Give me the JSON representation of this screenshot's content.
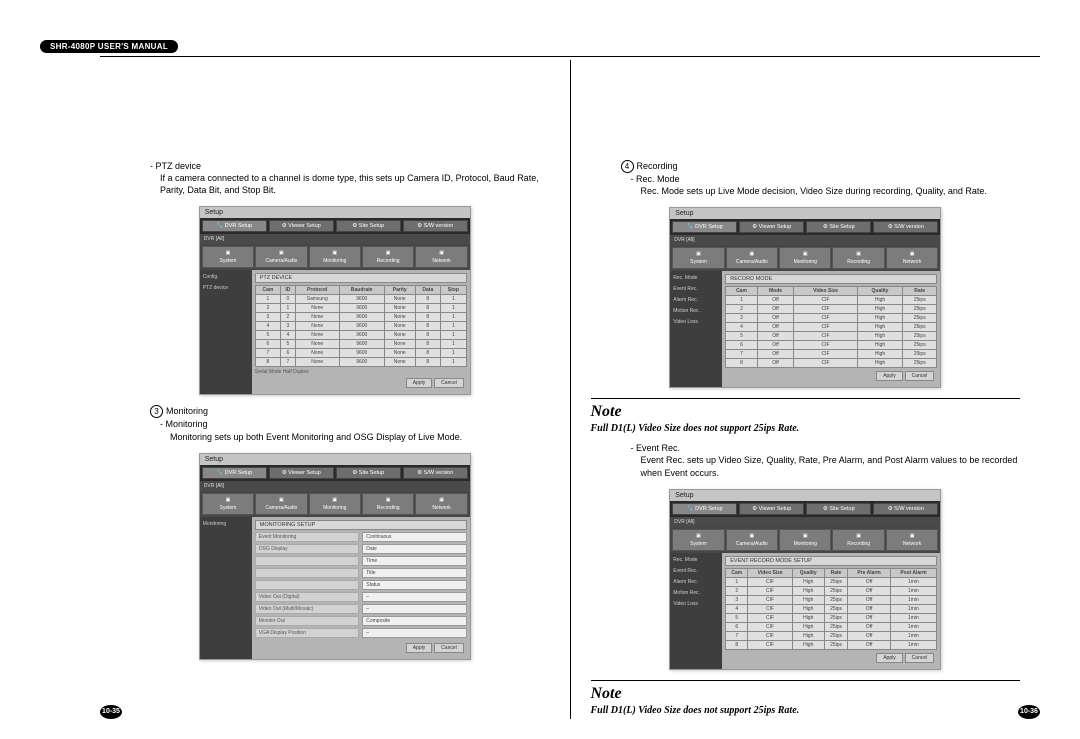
{
  "header": "SHR-4080P USER'S MANUAL",
  "left": {
    "ptz": {
      "bullet": "- PTZ device",
      "text": "If a camera connected to a channel is dome type, this sets up Camera ID, Protocol, Baud Rate, Parity, Data Bit, and Stop Bit."
    },
    "mon_num": "3",
    "mon": {
      "head": "Monitoring",
      "bullet": "- Monitoring",
      "text": "Monitoring sets up both Event Monitoring and OSG Display of Live Mode."
    },
    "page": "10-35",
    "shot1": {
      "setup": "Setup",
      "tabs": [
        "DVR Setup",
        "Viewer Setup",
        "Site Setup",
        "S/W version"
      ],
      "nav": [
        "System",
        "Camera/Audio",
        "Monitoring",
        "Recording",
        "Network"
      ],
      "side": [
        "Config.",
        "PTZ device"
      ],
      "panel": "PTZ DEVICE",
      "headers": [
        "Cam",
        "ID",
        "Protocol",
        "Baudrate",
        "Parity",
        "Data",
        "Stop"
      ],
      "rows": [
        [
          "1",
          "0",
          "Samsung",
          "9600",
          "None",
          "8",
          "1"
        ],
        [
          "2",
          "1",
          "None",
          "9600",
          "None",
          "8",
          "1"
        ],
        [
          "3",
          "2",
          "None",
          "9600",
          "None",
          "8",
          "1"
        ],
        [
          "4",
          "3",
          "None",
          "9600",
          "None",
          "8",
          "1"
        ],
        [
          "5",
          "4",
          "None",
          "9600",
          "None",
          "8",
          "1"
        ],
        [
          "6",
          "5",
          "None",
          "9600",
          "None",
          "8",
          "1"
        ],
        [
          "7",
          "6",
          "None",
          "9600",
          "None",
          "8",
          "1"
        ],
        [
          "8",
          "7",
          "None",
          "9600",
          "None",
          "8",
          "1"
        ]
      ],
      "serial": "Serial Mode   Half Duplex",
      "btns": [
        "Apply",
        "Cancel"
      ]
    },
    "shot2": {
      "setup": "Setup",
      "tabs": [
        "DVR Setup",
        "Viewer Setup",
        "Site Setup",
        "S/W version"
      ],
      "nav": [
        "System",
        "Camera/Audio",
        "Monitoring",
        "Recording",
        "Network"
      ],
      "side": [
        "Monitoring"
      ],
      "panel": "MONITORING SETUP",
      "form": [
        [
          "Event Monitoring",
          "Continuous"
        ],
        [
          "OSG Display",
          "Date"
        ],
        [
          "",
          "Time"
        ],
        [
          "",
          "Title"
        ],
        [
          "",
          "Status"
        ],
        [
          "Video Out (Digital)",
          "–"
        ],
        [
          "Video Out (Multi/Mosaic)",
          "–"
        ],
        [
          "Monitor Out",
          "Composite"
        ],
        [
          "VGA Display Position",
          "–"
        ]
      ],
      "btns": [
        "Apply",
        "Cancel"
      ]
    }
  },
  "right": {
    "rec_num": "4",
    "rec": {
      "head": "Recording",
      "bullet": "- Rec. Mode",
      "text": "Rec. Mode sets up Live Mode decision, Video Size during recording, Quality, and Rate."
    },
    "note": "Note",
    "note_text": "Full D1(L) Video Size does not support 25ips Rate.",
    "event": {
      "bullet": "- Event Rec.",
      "text": "Event Rec. sets up Video Size, Quality, Rate, Pre Alarm, and Post Alarm values to be recorded when Event occurs."
    },
    "page": "10-36",
    "shot1": {
      "setup": "Setup",
      "tabs": [
        "DVR Setup",
        "Viewer Setup",
        "Site Setup",
        "S/W version"
      ],
      "nav": [
        "System",
        "Camera/Audio",
        "Monitoring",
        "Recording",
        "Network"
      ],
      "side": [
        "Rec. Mode",
        "Event Rec.",
        "Alarm Rec.",
        "Motion Rec.",
        "Video Loss"
      ],
      "panel": "RECORD MODE",
      "headers": [
        "Cam",
        "Mode",
        "Video Size",
        "Quality",
        "Rate"
      ],
      "rows": [
        [
          "1",
          "Off",
          "CIF",
          "High",
          "25ips"
        ],
        [
          "2",
          "Off",
          "CIF",
          "High",
          "25ips"
        ],
        [
          "3",
          "Off",
          "CIF",
          "High",
          "25ips"
        ],
        [
          "4",
          "Off",
          "CIF",
          "High",
          "25ips"
        ],
        [
          "5",
          "Off",
          "CIF",
          "High",
          "25ips"
        ],
        [
          "6",
          "Off",
          "CIF",
          "High",
          "25ips"
        ],
        [
          "7",
          "Off",
          "CIF",
          "High",
          "25ips"
        ],
        [
          "8",
          "Off",
          "CIF",
          "High",
          "25ips"
        ]
      ],
      "btns": [
        "Apply",
        "Cancel"
      ]
    },
    "shot2": {
      "setup": "Setup",
      "tabs": [
        "DVR Setup",
        "Viewer Setup",
        "Site Setup",
        "S/W version"
      ],
      "nav": [
        "System",
        "Camera/Audio",
        "Monitoring",
        "Recording",
        "Network"
      ],
      "side": [
        "Rec. Mode",
        "Event Rec.",
        "Alarm Rec.",
        "Motion Rec.",
        "Video Loss"
      ],
      "panel": "EVENT RECORD MODE SETUP",
      "headers": [
        "Cam",
        "Video Size",
        "Quality",
        "Rate",
        "Pre Alarm",
        "Post Alarm"
      ],
      "rows": [
        [
          "1",
          "CIF",
          "High",
          "25ips",
          "Off",
          "1min"
        ],
        [
          "2",
          "CIF",
          "High",
          "25ips",
          "Off",
          "1min"
        ],
        [
          "3",
          "CIF",
          "High",
          "25ips",
          "Off",
          "1min"
        ],
        [
          "4",
          "CIF",
          "High",
          "25ips",
          "Off",
          "1min"
        ],
        [
          "5",
          "CIF",
          "High",
          "25ips",
          "Off",
          "1min"
        ],
        [
          "6",
          "CIF",
          "High",
          "25ips",
          "Off",
          "1min"
        ],
        [
          "7",
          "CIF",
          "High",
          "25ips",
          "Off",
          "1min"
        ],
        [
          "8",
          "CIF",
          "High",
          "25ips",
          "Off",
          "1min"
        ]
      ],
      "btns": [
        "Apply",
        "Cancel"
      ]
    }
  }
}
